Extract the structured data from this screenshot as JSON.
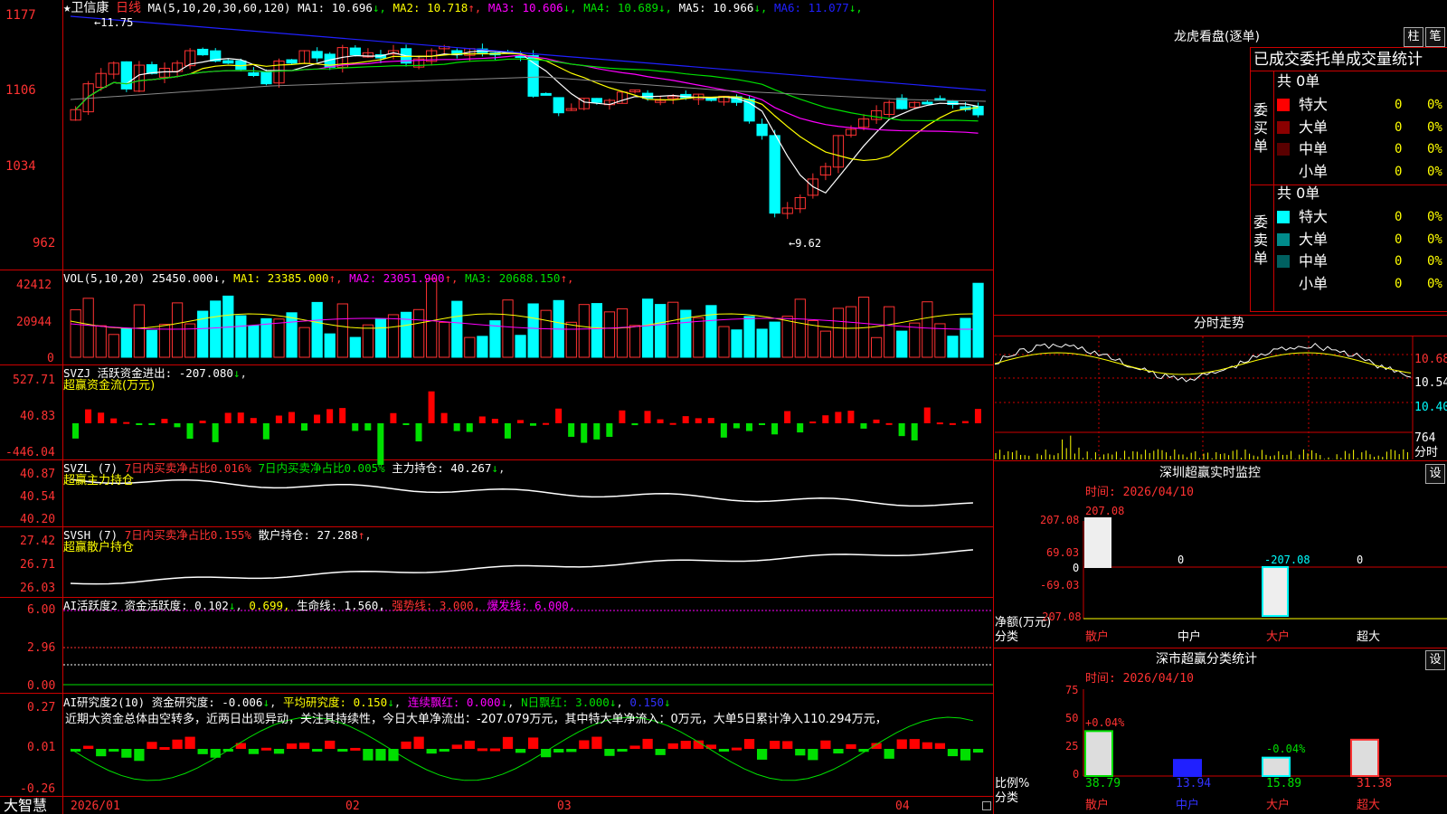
{
  "colors": {
    "up": "#ff3232",
    "down": "#00ffff",
    "ma1": "#ffffff",
    "ma2": "#ffff00",
    "ma3": "#ff00ff",
    "ma4": "#00e000",
    "ma5": "#808080",
    "ma6": "#2020ff",
    "axis": "#c00000"
  },
  "main": {
    "title": "★卫信康",
    "period": "日线",
    "ma_label": "MA(5,10,20,30,60,120)",
    "ma": [
      {
        "name": "MA1:",
        "value": "10.696",
        "arrow": "↓",
        "color": "#ffffff"
      },
      {
        "name": "MA2:",
        "value": "10.718",
        "arrow": "↑",
        "color": "#ffff00"
      },
      {
        "name": "MA3:",
        "value": "10.606",
        "arrow": "↓",
        "color": "#ff00ff"
      },
      {
        "name": "MA4:",
        "value": "10.689",
        "arrow": "↓",
        "color": "#00e000"
      },
      {
        "name": "MA5:",
        "value": "10.966",
        "arrow": "↓",
        "color": "#ffffff"
      },
      {
        "name": "MA6:",
        "value": "11.077",
        "arrow": "↓",
        "color": "#2020ff"
      }
    ],
    "yticks": [
      "1177",
      "1106",
      "1034",
      "962"
    ],
    "high_label": "11.75",
    "low_label": "9.62"
  },
  "vol": {
    "label": "VOL(5,10,20)",
    "value": "25450.000",
    "ma": [
      {
        "name": "MA1:",
        "value": "23385.000",
        "arrow": "↑",
        "color": "#ffff00"
      },
      {
        "name": "MA2:",
        "value": "23051.900",
        "arrow": "↑",
        "color": "#ff00ff"
      },
      {
        "name": "MA3:",
        "value": "20688.150",
        "arrow": "↑",
        "color": "#00e000"
      }
    ],
    "yticks": [
      "42412",
      "20944",
      "0"
    ]
  },
  "svzj": {
    "label": "SVZJ",
    "item": "活跃资金进出:",
    "value": "-207.080",
    "sub": "超赢资金流(万元)",
    "yticks": [
      "527.71",
      "40.83",
      "-446.04"
    ]
  },
  "svzl": {
    "label": "SVZL (7)",
    "a": "7日内买卖净占比0.016%",
    "b": "7日内买卖净占比0.005%",
    "c": "主力持仓: 40.267",
    "sub": "超赢主力持仓",
    "yticks": [
      "40.87",
      "40.54",
      "40.20"
    ]
  },
  "svsh": {
    "label": "SVSH (7)",
    "a": "7日内买卖净占比0.155%",
    "c": "散户持仓: 27.288",
    "sub": "超赢散户持仓",
    "yticks": [
      "27.42",
      "26.71",
      "26.03"
    ]
  },
  "ai1": {
    "label": "AI活跃度2",
    "a": "资金活跃度: 0.102",
    "b": "0.699,",
    "c": "生命线: 1.560,",
    "d": "强势线: 3.000,",
    "e": "爆发线: 6.000,",
    "yticks": [
      "6.00",
      "2.96",
      "0.00"
    ]
  },
  "ai2": {
    "label": "AI研究度2(10)",
    "a": "资金研究度: -0.006",
    "b": "平均研究度: 0.150",
    "c": "连续飘红: 0.000",
    "d": "N日飘红: 3.000",
    "e": "0.150",
    "comment": "近期大资金总体由空转多，近两日出现异动，关注其持续性，今日大单净流出：-207.079万元，其中特大单净流入：0万元，大单5日累计净入110.294万元，",
    "yticks": [
      "0.27",
      "0.01",
      "-0.26"
    ]
  },
  "footer": {
    "brand": "大智慧",
    "dates": [
      "2026/01",
      "02",
      "03",
      "04"
    ]
  },
  "lhb": {
    "title": "龙虎看盘(逐单)",
    "btn1": "柱",
    "btn2": "笔",
    "tabs": "已成交委托单成交量统计",
    "buy": {
      "side": "委买单",
      "total": "共 0单",
      "rows": [
        {
          "name": "特大",
          "count": "0",
          "pct": "0%",
          "color": "#ff0000"
        },
        {
          "name": "大单",
          "count": "0",
          "pct": "0%",
          "color": "#8b0000"
        },
        {
          "name": "中单",
          "count": "0",
          "pct": "0%",
          "color": "#5a0000"
        },
        {
          "name": "小单",
          "count": "0",
          "pct": "0%",
          "color": ""
        }
      ]
    },
    "sell": {
      "side": "委卖单",
      "total": "共 0单",
      "rows": [
        {
          "name": "特大",
          "count": "0",
          "pct": "0%",
          "color": "#00ffff"
        },
        {
          "name": "大单",
          "count": "0",
          "pct": "0%",
          "color": "#008b8b"
        },
        {
          "name": "中单",
          "count": "0",
          "pct": "0%",
          "color": "#006060"
        },
        {
          "name": "小单",
          "count": "0",
          "pct": "0%",
          "color": ""
        }
      ]
    }
  },
  "intraday": {
    "title": "分时走势",
    "prices": [
      "10.68",
      "10.54",
      "10.40"
    ],
    "vol": "764",
    "vol_label": "分时"
  },
  "monitor": {
    "title": "深圳超赢实时监控",
    "btn": "设",
    "time": "时间: 2026/04/10",
    "yticks": [
      "207.08",
      "69.03",
      "0",
      "-69.03",
      "-207.08"
    ],
    "ylabel": "净额(万元)",
    "xlabel": "分类",
    "top": "207.08",
    "vals": [
      "0",
      "-207.08",
      "0"
    ],
    "cats": [
      "散户",
      "中户",
      "大户",
      "超大"
    ],
    "net": [
      207.08,
      0,
      -207.08,
      0
    ]
  },
  "stats": {
    "title": "深市超赢分类统计",
    "btn": "设",
    "time": "时间: 2026/04/10",
    "yticks": [
      "75",
      "50",
      "25",
      "0"
    ],
    "ylabel": "比例%",
    "xlabel": "分类",
    "pcts": [
      "+0.04%",
      "-0.04%"
    ],
    "vals": [
      "38.79",
      "13.94",
      "15.89",
      "31.38"
    ],
    "cats": [
      "散户",
      "中户",
      "大户",
      "超大"
    ],
    "shares": [
      38.79,
      13.94,
      15.89,
      31.38
    ]
  }
}
